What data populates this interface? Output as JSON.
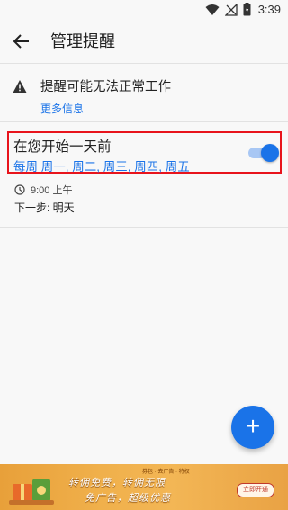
{
  "status_bar": {
    "time": "3:39"
  },
  "app_bar": {
    "title": "管理提醒"
  },
  "warning": {
    "message": "提醒可能无法正常工作",
    "link": "更多信息"
  },
  "reminder": {
    "title": "在您开始一天前",
    "days": "每周 周一, 周二, 周三, 周四, 周五",
    "enabled": true,
    "time": "9:00 上午",
    "next": "下一步: 明天"
  },
  "fab": {
    "icon": "plus-icon",
    "label": "+"
  },
  "ad": {
    "tags": "券包 · 去广告 · 特权",
    "line1": "转佣免费，转佣无限",
    "line2": "免广告，超级优惠",
    "button": "立即开通"
  },
  "colors": {
    "accent": "#1a73e8",
    "highlight_border": "#e8141c",
    "ad_bg": "#f0b04b"
  }
}
